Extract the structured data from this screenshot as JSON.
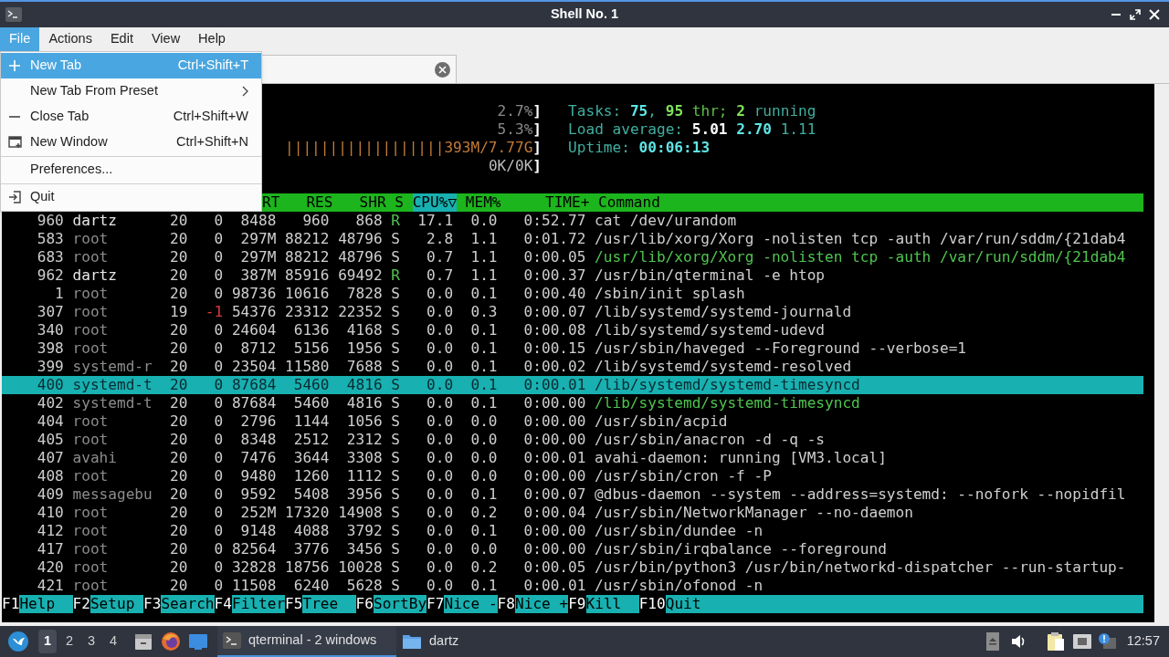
{
  "window": {
    "title": "Shell No. 1"
  },
  "menubar": [
    {
      "label": "File",
      "selected": true
    },
    {
      "label": "Actions",
      "selected": false
    },
    {
      "label": "Edit",
      "selected": false
    },
    {
      "label": "View",
      "selected": false
    },
    {
      "label": "Help",
      "selected": false
    }
  ],
  "file_menu": [
    {
      "kind": "item",
      "label": "New Tab",
      "shortcut": "Ctrl+Shift+T",
      "selected": true
    },
    {
      "kind": "submenu",
      "label": "New Tab From Preset",
      "selected": false
    },
    {
      "kind": "item",
      "label": "Close Tab",
      "shortcut": "Ctrl+Shift+W",
      "selected": false
    },
    {
      "kind": "item",
      "label": "New Window",
      "shortcut": "Ctrl+Shift+N",
      "selected": false
    },
    {
      "kind": "separator"
    },
    {
      "kind": "item",
      "label": "Preferences...",
      "selected": false
    },
    {
      "kind": "separator"
    },
    {
      "kind": "item",
      "label": "Quit",
      "selected": false
    }
  ],
  "meters": [
    {
      "kind": "dim",
      "reading": "2.7%",
      "end": "]"
    },
    {
      "kind": "dim",
      "reading": "5.3%",
      "end": "]"
    },
    {
      "kind": "bar",
      "bar": "||||||||||||||||||",
      "reading": "393M/7.77G",
      "end": "]"
    },
    {
      "kind": "plain",
      "reading": "0K/0K",
      "end": "]"
    }
  ],
  "summary": [
    [
      {
        "kind": "label",
        "text": "Tasks:"
      },
      {
        "kind": "cyan",
        "text": "75"
      },
      {
        "kind": "punct",
        "text": ","
      },
      {
        "kind": "green",
        "text": "95"
      },
      {
        "kind": "greenlabel",
        "text": "thr;"
      },
      {
        "kind": "green",
        "text": "2"
      },
      {
        "kind": "label",
        "text": "running"
      }
    ],
    [
      {
        "kind": "label",
        "text": "Load average:"
      },
      {
        "kind": "white",
        "text": "5.01"
      },
      {
        "kind": "cyan",
        "text": "2.70"
      },
      {
        "kind": "label",
        "text": "1.11"
      }
    ],
    [
      {
        "kind": "label",
        "text": "Uptime:"
      },
      {
        "kind": "cyan",
        "text": "00:06:13"
      }
    ]
  ],
  "table": {
    "columns": [
      {},
      {},
      {},
      {},
      {
        "label": "RT",
        "sorted": false
      },
      {
        "label": "RES",
        "sorted": false
      },
      {
        "label": "SHR",
        "sorted": false
      },
      {
        "label": "S",
        "sorted": false
      },
      {
        "label": "CPU%▽",
        "sorted": true
      },
      {
        "label": "MEM%",
        "sorted": false
      },
      {
        "label": "TIME+",
        "sorted": false
      },
      {
        "label": "Command",
        "sorted": false
      }
    ],
    "rows": [
      {
        "cells": [
          "960",
          "dartz",
          "20",
          "0",
          "8488",
          "960",
          "868",
          "R",
          "17.1",
          "0.0",
          "0:52.77",
          "cat /dev/urandom"
        ],
        "selected": false,
        "thread": false,
        "own": true,
        "running": true,
        "niced": false
      },
      {
        "cells": [
          "583",
          "root",
          "20",
          "0",
          "297M",
          "88212",
          "48796",
          "S",
          "2.8",
          "1.1",
          "0:01.72",
          "/usr/lib/xorg/Xorg -nolisten tcp -auth /var/run/sddm/{21dab4"
        ],
        "selected": false,
        "thread": false,
        "own": false,
        "running": false,
        "niced": false
      },
      {
        "cells": [
          "683",
          "root",
          "20",
          "0",
          "297M",
          "88212",
          "48796",
          "S",
          "0.7",
          "1.1",
          "0:00.05",
          "/usr/lib/xorg/Xorg -nolisten tcp -auth /var/run/sddm/{21dab4"
        ],
        "selected": false,
        "thread": true,
        "own": false,
        "running": false,
        "niced": false
      },
      {
        "cells": [
          "962",
          "dartz",
          "20",
          "0",
          "387M",
          "85916",
          "69492",
          "R",
          "0.7",
          "1.1",
          "0:00.37",
          "/usr/bin/qterminal -e htop"
        ],
        "selected": false,
        "thread": false,
        "own": true,
        "running": true,
        "niced": false
      },
      {
        "cells": [
          "1",
          "root",
          "20",
          "0",
          "98736",
          "10616",
          "7828",
          "S",
          "0.0",
          "0.1",
          "0:00.40",
          "/sbin/init splash"
        ],
        "selected": false,
        "thread": false,
        "own": false,
        "running": false,
        "niced": false
      },
      {
        "cells": [
          "307",
          "root",
          "19",
          "-1",
          "54376",
          "23312",
          "22352",
          "S",
          "0.0",
          "0.3",
          "0:00.07",
          "/lib/systemd/systemd-journald"
        ],
        "selected": false,
        "thread": false,
        "own": false,
        "running": false,
        "niced": true
      },
      {
        "cells": [
          "340",
          "root",
          "20",
          "0",
          "24604",
          "6136",
          "4168",
          "S",
          "0.0",
          "0.1",
          "0:00.08",
          "/lib/systemd/systemd-udevd"
        ],
        "selected": false,
        "thread": false,
        "own": false,
        "running": false,
        "niced": false
      },
      {
        "cells": [
          "398",
          "root",
          "20",
          "0",
          "8712",
          "5156",
          "1956",
          "S",
          "0.0",
          "0.1",
          "0:00.15",
          "/usr/sbin/haveged --Foreground --verbose=1"
        ],
        "selected": false,
        "thread": false,
        "own": false,
        "running": false,
        "niced": false
      },
      {
        "cells": [
          "399",
          "systemd-r",
          "20",
          "0",
          "23504",
          "11580",
          "7688",
          "S",
          "0.0",
          "0.1",
          "0:00.02",
          "/lib/systemd/systemd-resolved"
        ],
        "selected": false,
        "thread": false,
        "own": false,
        "running": false,
        "niced": false
      },
      {
        "cells": [
          "400",
          "systemd-t",
          "20",
          "0",
          "87684",
          "5460",
          "4816",
          "S",
          "0.0",
          "0.1",
          "0:00.01",
          "/lib/systemd/systemd-timesyncd"
        ],
        "selected": true,
        "thread": false,
        "own": false,
        "running": false,
        "niced": false
      },
      {
        "cells": [
          "402",
          "systemd-t",
          "20",
          "0",
          "87684",
          "5460",
          "4816",
          "S",
          "0.0",
          "0.1",
          "0:00.00",
          "/lib/systemd/systemd-timesyncd"
        ],
        "selected": false,
        "thread": true,
        "own": false,
        "running": false,
        "niced": false
      },
      {
        "cells": [
          "404",
          "root",
          "20",
          "0",
          "2796",
          "1144",
          "1056",
          "S",
          "0.0",
          "0.0",
          "0:00.00",
          "/usr/sbin/acpid"
        ],
        "selected": false,
        "thread": false,
        "own": false,
        "running": false,
        "niced": false
      },
      {
        "cells": [
          "405",
          "root",
          "20",
          "0",
          "8348",
          "2512",
          "2312",
          "S",
          "0.0",
          "0.0",
          "0:00.00",
          "/usr/sbin/anacron -d -q -s"
        ],
        "selected": false,
        "thread": false,
        "own": false,
        "running": false,
        "niced": false
      },
      {
        "cells": [
          "407",
          "avahi",
          "20",
          "0",
          "7476",
          "3644",
          "3308",
          "S",
          "0.0",
          "0.0",
          "0:00.01",
          "avahi-daemon: running [VM3.local]"
        ],
        "selected": false,
        "thread": false,
        "own": false,
        "running": false,
        "niced": false
      },
      {
        "cells": [
          "408",
          "root",
          "20",
          "0",
          "9480",
          "1260",
          "1112",
          "S",
          "0.0",
          "0.0",
          "0:00.00",
          "/usr/sbin/cron -f -P"
        ],
        "selected": false,
        "thread": false,
        "own": false,
        "running": false,
        "niced": false
      },
      {
        "cells": [
          "409",
          "messagebu",
          "20",
          "0",
          "9592",
          "5408",
          "3956",
          "S",
          "0.0",
          "0.1",
          "0:00.07",
          "@dbus-daemon --system --address=systemd: --nofork --nopidfil"
        ],
        "selected": false,
        "thread": false,
        "own": false,
        "running": false,
        "niced": false
      },
      {
        "cells": [
          "410",
          "root",
          "20",
          "0",
          "252M",
          "17320",
          "14908",
          "S",
          "0.0",
          "0.2",
          "0:00.04",
          "/usr/sbin/NetworkManager --no-daemon"
        ],
        "selected": false,
        "thread": false,
        "own": false,
        "running": false,
        "niced": false
      },
      {
        "cells": [
          "412",
          "root",
          "20",
          "0",
          "9148",
          "4088",
          "3792",
          "S",
          "0.0",
          "0.1",
          "0:00.00",
          "/usr/sbin/dundee -n"
        ],
        "selected": false,
        "thread": false,
        "own": false,
        "running": false,
        "niced": false
      },
      {
        "cells": [
          "417",
          "root",
          "20",
          "0",
          "82564",
          "3776",
          "3456",
          "S",
          "0.0",
          "0.0",
          "0:00.00",
          "/usr/sbin/irqbalance --foreground"
        ],
        "selected": false,
        "thread": false,
        "own": false,
        "running": false,
        "niced": false
      },
      {
        "cells": [
          "420",
          "root",
          "20",
          "0",
          "32828",
          "18756",
          "10028",
          "S",
          "0.0",
          "0.2",
          "0:00.05",
          "/usr/bin/python3 /usr/bin/networkd-dispatcher --run-startup-"
        ],
        "selected": false,
        "thread": false,
        "own": false,
        "running": false,
        "niced": false
      },
      {
        "cells": [
          "421",
          "root",
          "20",
          "0",
          "11508",
          "6240",
          "5628",
          "S",
          "0.0",
          "0.1",
          "0:00.01",
          "/usr/sbin/ofonod -n"
        ],
        "selected": false,
        "thread": false,
        "own": false,
        "running": false,
        "niced": false
      }
    ]
  },
  "function_keys": [
    {
      "key": "F1",
      "label": "Help"
    },
    {
      "key": "F2",
      "label": "Setup"
    },
    {
      "key": "F3",
      "label": "Search"
    },
    {
      "key": "F4",
      "label": "Filter"
    },
    {
      "key": "F5",
      "label": "Tree"
    },
    {
      "key": "F6",
      "label": "SortBy"
    },
    {
      "key": "F7",
      "label": "Nice -"
    },
    {
      "key": "F8",
      "label": "Nice +"
    },
    {
      "key": "F9",
      "label": "Kill"
    },
    {
      "key": "F10",
      "label": "Quit"
    }
  ],
  "taskbar": {
    "workspaces": [
      {
        "label": "1",
        "selected": true
      },
      {
        "label": "2",
        "selected": false
      },
      {
        "label": "3",
        "selected": false
      },
      {
        "label": "4",
        "selected": false
      }
    ],
    "tasks": [
      {
        "kind": "terminal",
        "label": "qterminal - 2 windows",
        "selected": true
      },
      {
        "kind": "folder",
        "label": "dartz",
        "selected": false
      }
    ],
    "clock": "12:57"
  }
}
